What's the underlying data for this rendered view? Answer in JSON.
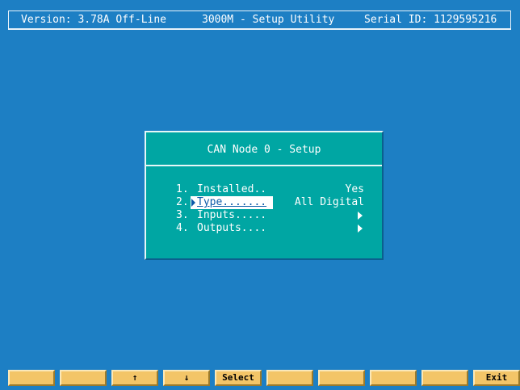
{
  "header": {
    "version": "Version: 3.78A Off-Line",
    "title": "3000M - Setup Utility",
    "serial": "Serial ID: 1129595216"
  },
  "dialog": {
    "title": "CAN Node 0 - Setup",
    "items": [
      {
        "num": "1.",
        "label": "Installed..",
        "value": "Yes",
        "has_submenu": false
      },
      {
        "num": "2.",
        "label": "Type.......",
        "value": "All Digital",
        "has_submenu": false,
        "selected": true
      },
      {
        "num": "3.",
        "label": "Inputs.....",
        "value": "",
        "has_submenu": true
      },
      {
        "num": "4.",
        "label": "Outputs....",
        "value": "",
        "has_submenu": true
      }
    ]
  },
  "function_keys": [
    "",
    "",
    "↑",
    "↓",
    "Select",
    "",
    "",
    "",
    "",
    "Exit"
  ],
  "colors": {
    "background": "#1d7fc4",
    "dialog": "#00a6a3",
    "function_key": "#f3c568",
    "selection": "#ffffff"
  }
}
